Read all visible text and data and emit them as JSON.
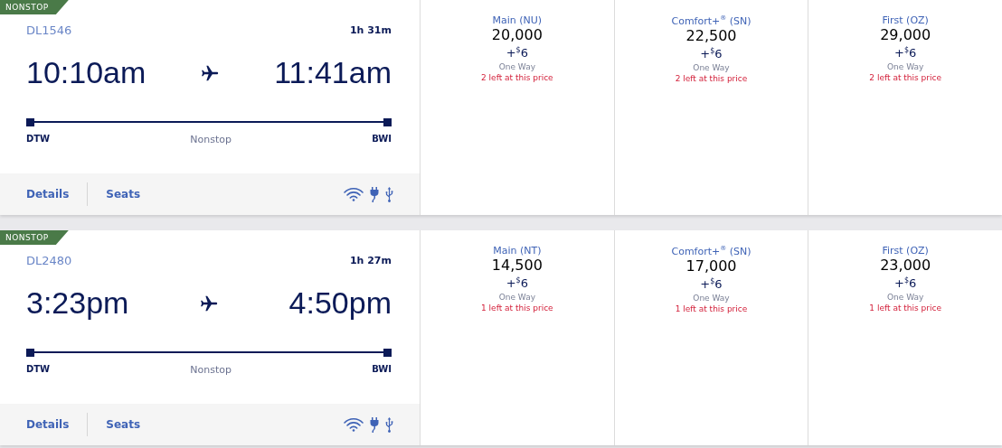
{
  "flights": [
    {
      "badge": "NONSTOP",
      "flight_number": "DL1546",
      "duration": "1h 31m",
      "depart_time": "10:10am",
      "arrive_time": "11:41am",
      "origin": "DTW",
      "stops": "Nonstop",
      "destination": "BWI",
      "links": [
        "Details",
        "Seats"
      ],
      "fares": [
        {
          "cabin": "Main (NU)",
          "miles": "20,000",
          "fee_prefix": "+",
          "fee_currency": "$",
          "fee_amount": "6",
          "trip": "One Way",
          "seats_left": "2 left at this price"
        },
        {
          "cabin": "Comfort+$^{®}$ (SN)",
          "miles": "22,500",
          "fee_prefix": "+",
          "fee_currency": "$",
          "fee_amount": "6",
          "trip": "One Way",
          "seats_left": "2 left at this price"
        },
        {
          "cabin": "First (OZ)",
          "miles": "29,000",
          "fee_prefix": "+",
          "fee_currency": "$",
          "fee_amount": "6",
          "trip": "One Way",
          "seats_left": "2 left at this price"
        }
      ]
    },
    {
      "badge": "NONSTOP",
      "flight_number": "DL2480",
      "duration": "1h 27m",
      "depart_time": "3:23pm",
      "arrive_time": "4:50pm",
      "origin": "DTW",
      "stops": "Nonstop",
      "destination": "BWI",
      "links": [
        "Details",
        "Seats"
      ],
      "fares": [
        {
          "cabin": "Main (NT)",
          "miles": "14,500",
          "fee_prefix": "+",
          "fee_currency": "$",
          "fee_amount": "6",
          "trip": "One Way",
          "seats_left": "1 left at this price"
        },
        {
          "cabin": "Comfort+$^{®}$ (SN)",
          "miles": "17,000",
          "fee_prefix": "+",
          "fee_currency": "$",
          "fee_amount": "6",
          "trip": "One Way",
          "seats_left": "1 left at this price"
        },
        {
          "cabin": "First (OZ)",
          "miles": "23,000",
          "fee_prefix": "+",
          "fee_currency": "$",
          "fee_amount": "6",
          "trip": "One Way",
          "seats_left": "1 left at this price"
        }
      ]
    }
  ]
}
